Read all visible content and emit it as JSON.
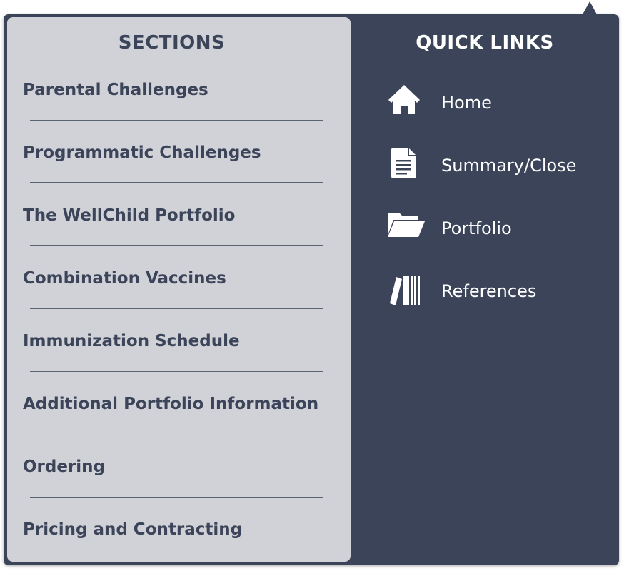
{
  "sections": {
    "title": "SECTIONS",
    "items": [
      {
        "label": "Parental Challenges"
      },
      {
        "label": "Programmatic Challenges"
      },
      {
        "label": "The WellChild Portfolio"
      },
      {
        "label": "Combination Vaccines"
      },
      {
        "label": "Immunization Schedule"
      },
      {
        "label": "Additional Portfolio Information"
      },
      {
        "label": "Ordering"
      },
      {
        "label": "Pricing and Contracting"
      }
    ]
  },
  "quick_links": {
    "title": "QUICK LINKS",
    "items": [
      {
        "label": "Home",
        "icon": "home-icon"
      },
      {
        "label": "Summary/Close",
        "icon": "document-icon"
      },
      {
        "label": "Portfolio",
        "icon": "folder-icon"
      },
      {
        "label": "References",
        "icon": "books-icon"
      }
    ]
  },
  "colors": {
    "panel_dark": "#3b4458",
    "panel_light": "#d1d2d8",
    "text_dark": "#3b4458",
    "text_light": "#ffffff"
  }
}
